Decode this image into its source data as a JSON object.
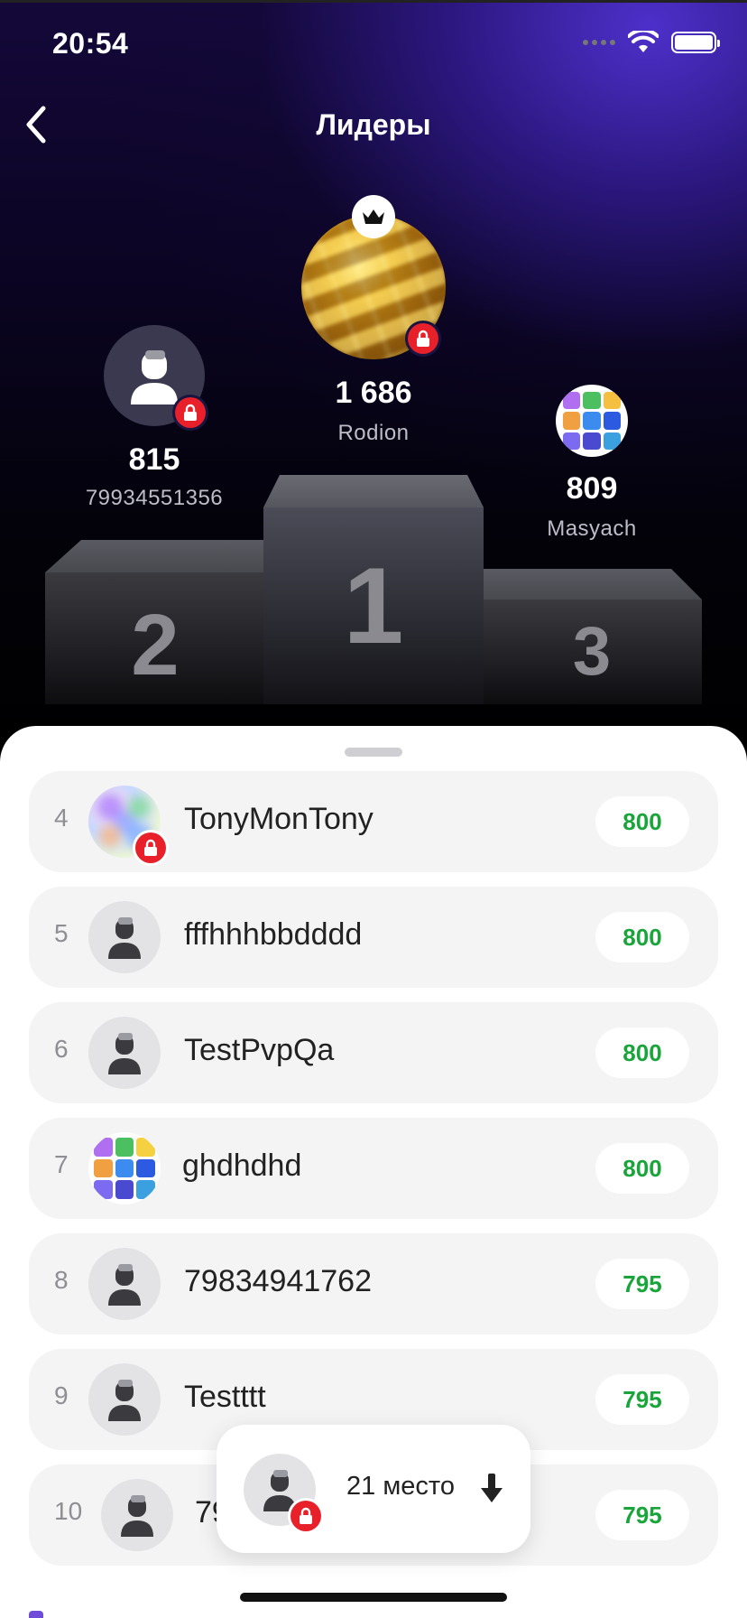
{
  "status_bar": {
    "time": "20:54"
  },
  "header": {
    "title": "Лидеры"
  },
  "podium": {
    "first": {
      "rank_label": "1",
      "score": "1 686",
      "name": "Rodion"
    },
    "second": {
      "rank_label": "2",
      "score": "815",
      "name": "79934551356"
    },
    "third": {
      "rank_label": "3",
      "score": "809",
      "name": "Masyach"
    }
  },
  "leaderboard": [
    {
      "rank": "4",
      "name": "TonyMonTony",
      "score": "800",
      "avatar": "blurred-photo",
      "locked": true
    },
    {
      "rank": "5",
      "name": "fffhhhbbdddd",
      "score": "800",
      "avatar": "default-user",
      "locked": false
    },
    {
      "rank": "6",
      "name": "TestPvpQa",
      "score": "800",
      "avatar": "default-user",
      "locked": false
    },
    {
      "rank": "7",
      "name": "ghdhdhd",
      "score": "800",
      "avatar": "app-grid-photo",
      "locked": false
    },
    {
      "rank": "8",
      "name": "79834941762",
      "score": "795",
      "avatar": "default-user",
      "locked": false
    },
    {
      "rank": "9",
      "name": "Testttt",
      "score": "795",
      "avatar": "default-user",
      "locked": false
    },
    {
      "rank": "10",
      "name": "79",
      "score": "795",
      "avatar": "default-user",
      "locked": false
    }
  ],
  "my_position": {
    "label": "21 место"
  },
  "colors": {
    "score_green": "#1aa53a",
    "lock_red": "#e8202a",
    "hero_purple": "#3a22b0"
  },
  "icons": [
    "back-chevron-icon",
    "wifi-icon",
    "battery-icon",
    "crown-icon",
    "lock-icon",
    "user-icon",
    "arrow-down-icon"
  ]
}
